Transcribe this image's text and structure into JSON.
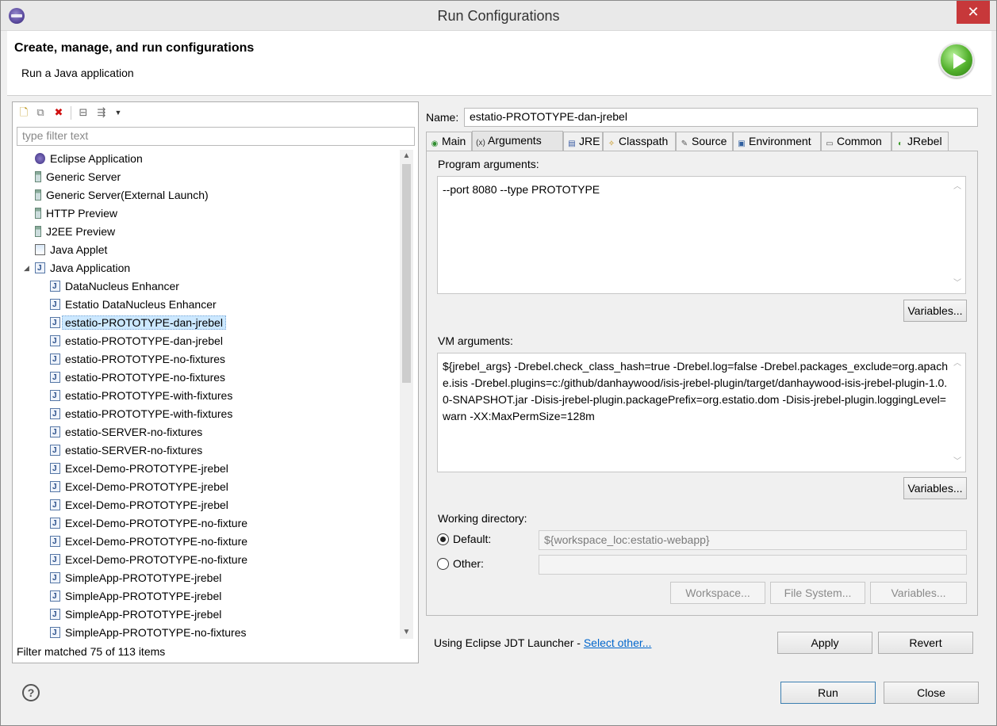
{
  "window": {
    "title": "Run Configurations",
    "close_glyph": "✕"
  },
  "header": {
    "title": "Create, manage, and run configurations",
    "subtitle": "Run a Java application"
  },
  "left": {
    "filter_placeholder": "type filter text",
    "status": "Filter matched 75 of 113 items",
    "tree": [
      {
        "label": "Eclipse Application",
        "icon": "eclipse-icon",
        "level": 0
      },
      {
        "label": "Generic Server",
        "icon": "server-icon",
        "level": 0
      },
      {
        "label": "Generic Server(External Launch)",
        "icon": "server-icon",
        "level": 0
      },
      {
        "label": "HTTP Preview",
        "icon": "server-icon",
        "level": 0
      },
      {
        "label": "J2EE Preview",
        "icon": "server-icon",
        "level": 0
      },
      {
        "label": "Java Applet",
        "icon": "applet-icon",
        "level": 0
      },
      {
        "label": "Java Application",
        "icon": "java-app-icon",
        "level": 0,
        "expanded": true
      },
      {
        "label": "DataNucleus Enhancer",
        "icon": "java-app-icon",
        "level": 1
      },
      {
        "label": "Estatio DataNucleus Enhancer",
        "icon": "java-app-icon",
        "level": 1
      },
      {
        "label": "estatio-PROTOTYPE-dan-jrebel",
        "icon": "java-app-icon",
        "level": 1,
        "selected": true
      },
      {
        "label": "estatio-PROTOTYPE-dan-jrebel",
        "icon": "java-app-icon",
        "level": 1
      },
      {
        "label": "estatio-PROTOTYPE-no-fixtures",
        "icon": "java-app-icon",
        "level": 1
      },
      {
        "label": "estatio-PROTOTYPE-no-fixtures",
        "icon": "java-app-icon",
        "level": 1
      },
      {
        "label": "estatio-PROTOTYPE-with-fixtures",
        "icon": "java-app-icon",
        "level": 1
      },
      {
        "label": "estatio-PROTOTYPE-with-fixtures",
        "icon": "java-app-icon",
        "level": 1
      },
      {
        "label": "estatio-SERVER-no-fixtures",
        "icon": "java-app-icon",
        "level": 1
      },
      {
        "label": "estatio-SERVER-no-fixtures",
        "icon": "java-app-icon",
        "level": 1
      },
      {
        "label": "Excel-Demo-PROTOTYPE-jrebel",
        "icon": "java-app-icon",
        "level": 1
      },
      {
        "label": "Excel-Demo-PROTOTYPE-jrebel",
        "icon": "java-app-icon",
        "level": 1
      },
      {
        "label": "Excel-Demo-PROTOTYPE-jrebel",
        "icon": "java-app-icon",
        "level": 1
      },
      {
        "label": "Excel-Demo-PROTOTYPE-no-fixture",
        "icon": "java-app-icon",
        "level": 1
      },
      {
        "label": "Excel-Demo-PROTOTYPE-no-fixture",
        "icon": "java-app-icon",
        "level": 1
      },
      {
        "label": "Excel-Demo-PROTOTYPE-no-fixture",
        "icon": "java-app-icon",
        "level": 1
      },
      {
        "label": "SimpleApp-PROTOTYPE-jrebel",
        "icon": "java-app-icon",
        "level": 1
      },
      {
        "label": "SimpleApp-PROTOTYPE-jrebel",
        "icon": "java-app-icon",
        "level": 1
      },
      {
        "label": "SimpleApp-PROTOTYPE-jrebel",
        "icon": "java-app-icon",
        "level": 1
      },
      {
        "label": "SimpleApp-PROTOTYPE-no-fixtures",
        "icon": "java-app-icon",
        "level": 1
      }
    ]
  },
  "right": {
    "name_label": "Name:",
    "name_value": "estatio-PROTOTYPE-dan-jrebel",
    "tabs": [
      {
        "label": "Main",
        "icon": "main-tab-icon",
        "active": false
      },
      {
        "label": "Arguments",
        "icon": "arguments-tab-icon",
        "active": true
      },
      {
        "label": "JRE",
        "icon": "jre-tab-icon",
        "active": false
      },
      {
        "label": "Classpath",
        "icon": "classpath-tab-icon",
        "active": false
      },
      {
        "label": "Source",
        "icon": "source-tab-icon",
        "active": false
      },
      {
        "label": "Environment",
        "icon": "environment-tab-icon",
        "active": false
      },
      {
        "label": "Common",
        "icon": "common-tab-icon",
        "active": false
      },
      {
        "label": "JRebel",
        "icon": "jrebel-tab-icon",
        "active": false
      }
    ],
    "program_args": {
      "label": "Program arguments:",
      "value": "--port 8080 --type PROTOTYPE",
      "variables_button": "Variables..."
    },
    "vm_args": {
      "label": "VM arguments:",
      "value": "${jrebel_args} -Drebel.check_class_hash=true -Drebel.log=false -Drebel.packages_exclude=org.apache.isis -Drebel.plugins=c:/github/danhaywood/isis-jrebel-plugin/target/danhaywood-isis-jrebel-plugin-1.0.0-SNAPSHOT.jar -Disis-jrebel-plugin.packagePrefix=org.estatio.dom -Disis-jrebel-plugin.loggingLevel=warn -XX:MaxPermSize=128m",
      "variables_button": "Variables..."
    },
    "working_dir": {
      "label": "Working directory:",
      "default_label": "Default:",
      "default_value": "${workspace_loc:estatio-webapp}",
      "other_label": "Other:",
      "other_value": "",
      "workspace_button": "Workspace...",
      "filesystem_button": "File System...",
      "variables_button": "Variables..."
    },
    "launcher_text": "Using Eclipse JDT Launcher - ",
    "launcher_link": "Select other...",
    "apply_button": "Apply",
    "revert_button": "Revert"
  },
  "footer": {
    "help_glyph": "?",
    "run_button": "Run",
    "close_button": "Close"
  }
}
